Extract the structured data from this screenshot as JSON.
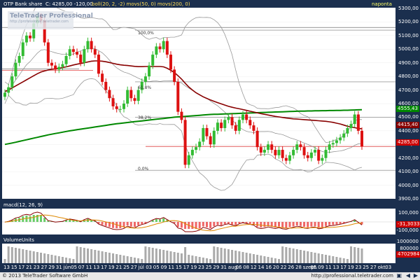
{
  "header": {
    "instrument": "OTP Bank share",
    "ohlc": "C: 4285,00 -120,00",
    "indicators": "boll(20, 2, -2) movs(50, 0) movs(200, 0)",
    "period": "napontа"
  },
  "watermark": {
    "brand": "TeleTrader Professional",
    "url": "http://professional.teletrader.com"
  },
  "fib_labels": [
    "100,0%",
    "61,8%",
    "38,2%",
    "0,0%"
  ],
  "badges": {
    "sma200": "4555,43",
    "sma50": "4415,40",
    "price": "4285,00"
  },
  "price_axis": [
    "5300,00",
    "5200,00",
    "5100,00",
    "5000,00",
    "4900,00",
    "4800,00",
    "4700,00",
    "4600,00",
    "4500,00",
    "4400,00",
    "4300,00",
    "4200,00",
    "4100,00",
    "4000,00",
    "3900,00"
  ],
  "macd": {
    "title": "macd(12, 26, 9)",
    "axis": [
      "100,000",
      "-31,3033",
      "-100,000"
    ]
  },
  "volume": {
    "title": "VolumeUnits",
    "axis": [
      "1000000",
      "800000",
      "4702984"
    ]
  },
  "date_axis": [
    "13",
    "15",
    "17",
    "21",
    "23",
    "27",
    "29",
    "31",
    "jún",
    "05",
    "07",
    "11",
    "13",
    "17",
    "19",
    "21",
    "25",
    "27",
    "júl",
    "03",
    "05",
    "09",
    "11",
    "15",
    "17",
    "19",
    "23",
    "25",
    "29",
    "31",
    "aug.",
    "06",
    "08",
    "12",
    "14",
    "16",
    "20",
    "22",
    "26",
    "28",
    "szept.",
    "05",
    "09",
    "11",
    "13",
    "17",
    "19",
    "23",
    "25",
    "27",
    "okt.",
    "03"
  ],
  "footer": {
    "copyright": "© 2013 TeleTrader Software GmbH",
    "url": "http://professional.teletrader.com"
  },
  "colors": {
    "up": "#33bb33",
    "down": "#dd1111",
    "sma50": "#880000",
    "sma200": "#008800",
    "boll": "#999999"
  },
  "chart_data": {
    "type": "candlestick",
    "title": "OTP Bank share",
    "ylim": [
      3900,
      5300
    ],
    "close": [
      4680,
      4720,
      4800,
      4900,
      4950,
      5050,
      5100,
      5080,
      5190,
      5240,
      5210,
      5050,
      4900,
      4880,
      4850,
      4870,
      4890,
      4950,
      5000,
      4980,
      4960,
      4900,
      5000,
      5060,
      5000,
      4960,
      4820,
      4760,
      4700,
      4640,
      4580,
      4560,
      4560,
      4600,
      4700,
      4640,
      4620,
      4700,
      4760,
      4800,
      4880,
      4960,
      5020,
      5000,
      5060,
      4960,
      4850,
      4760,
      4540,
      4480,
      4150,
      4220,
      4260,
      4280,
      4320,
      4420,
      4360,
      4300,
      4400,
      4460,
      4420,
      4480,
      4500,
      4440,
      4400,
      4480,
      4520,
      4480,
      4440,
      4400,
      4280,
      4240,
      4260,
      4300,
      4260,
      4220,
      4260,
      4200,
      4180,
      4220,
      4260,
      4300,
      4280,
      4220,
      4200,
      4240,
      4260,
      4180,
      4200,
      4260,
      4300,
      4310,
      4330,
      4350,
      4380,
      4420,
      4450,
      4520,
      4400,
      4285
    ],
    "sma50": [
      4690,
      4700,
      4715,
      4730,
      4745,
      4760,
      4775,
      4790,
      4805,
      4820,
      4832,
      4840,
      4847,
      4852,
      4856,
      4860,
      4865,
      4870,
      4877,
      4884,
      4890,
      4895,
      4900,
      4906,
      4912,
      4914,
      4914,
      4912,
      4908,
      4902,
      4896,
      4890,
      4885,
      4882,
      4880,
      4877,
      4874,
      4872,
      4872,
      4873,
      4873,
      4873,
      4873,
      4873,
      4870,
      4860,
      4845,
      4828,
      4805,
      4780,
      4750,
      4722,
      4700,
      4680,
      4665,
      4650,
      4638,
      4627,
      4617,
      4607,
      4598,
      4589,
      4580,
      4573,
      4567,
      4562,
      4556,
      4550,
      4544,
      4538,
      4532,
      4526,
      4521,
      4516,
      4511,
      4506,
      4502,
      4498,
      4494,
      4491,
      4488,
      4486,
      4484,
      4482,
      4480,
      4478,
      4476,
      4474,
      4472,
      4470,
      4466,
      4462,
      4456,
      4450,
      4442,
      4434,
      4428,
      4423,
      4418,
      4415
    ],
    "sma200": [
      4300,
      4305,
      4310,
      4316,
      4322,
      4328,
      4334,
      4340,
      4346,
      4352,
      4358,
      4364,
      4370,
      4375,
      4380,
      4385,
      4390,
      4395,
      4400,
      4404,
      4408,
      4412,
      4416,
      4420,
      4424,
      4428,
      4432,
      4436,
      4440,
      4444,
      4448,
      4452,
      4455,
      4458,
      4461,
      4464,
      4467,
      4470,
      4473,
      4476,
      4479,
      4482,
      4485,
      4488,
      4491,
      4494,
      4497,
      4500,
      4502,
      4504,
      4506,
      4508,
      4510,
      4512,
      4514,
      4516,
      4518,
      4520,
      4521,
      4522,
      4523,
      4524,
      4525,
      4526,
      4527,
      4528,
      4529,
      4530,
      4531,
      4532,
      4533,
      4534,
      4535,
      4536,
      4537,
      4538,
      4539,
      4540,
      4541,
      4542,
      4543,
      4544,
      4545,
      4545,
      4546,
      4546,
      4547,
      4547,
      4548,
      4548,
      4549,
      4549,
      4550,
      4550,
      4551,
      4551,
      4552,
      4553,
      4554,
      4555
    ]
  }
}
